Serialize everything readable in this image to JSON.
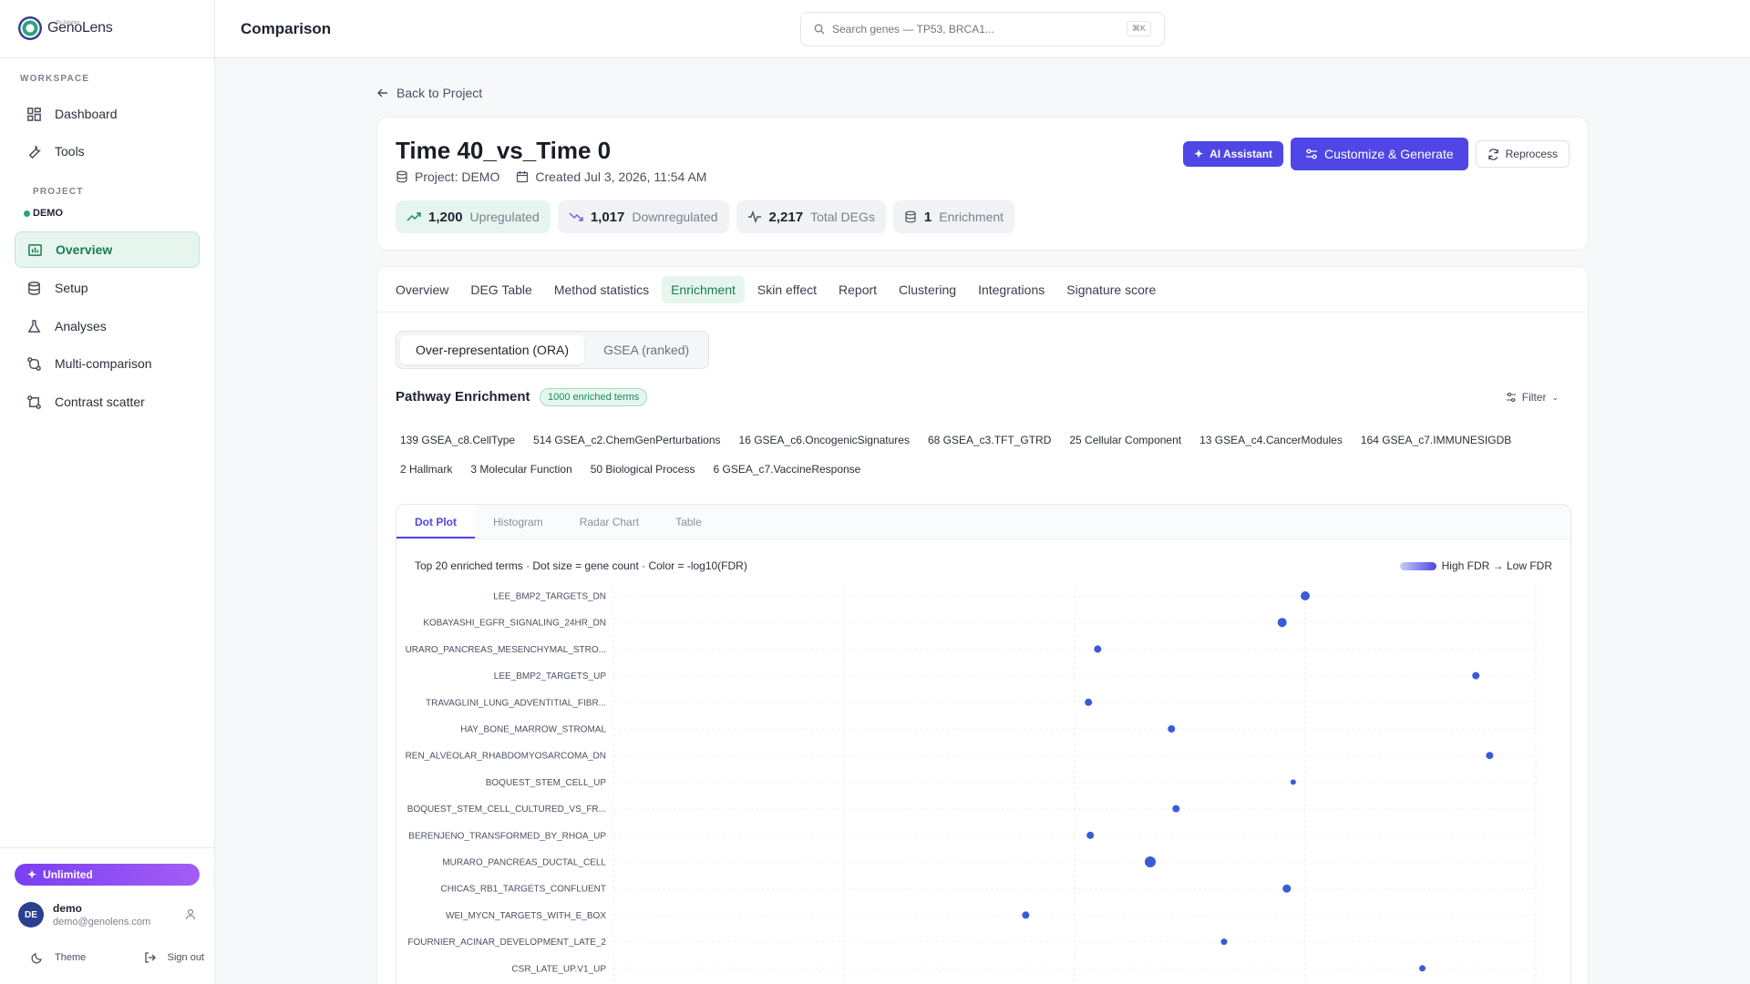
{
  "brand": {
    "name": "GenoLens",
    "sub": "By Solution"
  },
  "sidebar": {
    "workspace_label": "WORKSPACE",
    "workspace_items": [
      {
        "label": "Dashboard",
        "icon": "grid-icon"
      },
      {
        "label": "Tools",
        "icon": "wrench-icon"
      }
    ],
    "project_label": "PROJECT",
    "project_name": "DEMO",
    "project_items": [
      {
        "label": "Overview",
        "icon": "chart-icon",
        "active": true
      },
      {
        "label": "Setup",
        "icon": "database-icon"
      },
      {
        "label": "Analyses",
        "icon": "flask-icon"
      },
      {
        "label": "Multi-comparison",
        "icon": "compare-icon"
      },
      {
        "label": "Contrast scatter",
        "icon": "scatter-icon"
      }
    ],
    "plan": "Unlimited",
    "user": {
      "initials": "DE",
      "name": "demo",
      "email": "demo@genolens.com"
    },
    "theme_label": "Theme",
    "signout_label": "Sign out"
  },
  "topbar": {
    "title": "Comparison",
    "search_placeholder": "Search genes — TP53, BRCA1...",
    "kbd": "⌘K"
  },
  "header": {
    "back_label": "Back to Project",
    "title": "Time 40_vs_Time 0",
    "project": "Project: DEMO",
    "created": "Created Jul 3, 2026, 11:54 AM",
    "stats": [
      {
        "value": "1,200",
        "label": "Upregulated",
        "icon": "trend-up-icon"
      },
      {
        "value": "1,017",
        "label": "Downregulated",
        "icon": "trend-down-icon"
      },
      {
        "value": "2,217",
        "label": "Total DEGs",
        "icon": "activity-icon"
      },
      {
        "value": "1",
        "label": "Enrichment",
        "icon": "database-icon"
      }
    ],
    "ai_button": "AI Assistant",
    "generate_button": "Customize & Generate",
    "reprocess_button": "Reprocess"
  },
  "tabs": [
    "Overview",
    "DEG Table",
    "Method statistics",
    "Enrichment",
    "Skin effect",
    "Report",
    "Clustering",
    "Integrations",
    "Signature score"
  ],
  "active_tab": "Enrichment",
  "mode_tabs": [
    "Over-representation (ORA)",
    "GSEA (ranked)"
  ],
  "enrichment": {
    "title": "Pathway Enrichment",
    "badge": "1000 enriched terms",
    "filter_label": "Filter",
    "collections": [
      "139 GSEA_c8.CellType",
      "514 GSEA_c2.ChemGenPerturbations",
      "16 GSEA_c6.OncogenicSignatures",
      "68 GSEA_c3.TFT_GTRD",
      "25 Cellular Component",
      "13 GSEA_c4.CancerModules",
      "164 GSEA_c7.IMMUNESIGDB",
      "2 Hallmark",
      "3 Molecular Function",
      "50 Biological Process",
      "6 GSEA_c7.VaccineResponse"
    ],
    "plot_tabs": [
      "Dot Plot",
      "Histogram",
      "Radar Chart",
      "Table"
    ],
    "caption": "Top 20 enriched terms · Dot size = gene count · Color = -log10(FDR)",
    "legend": "High FDR → Low FDR"
  },
  "chart_data": {
    "type": "scatter",
    "title": "Top 20 enriched terms · Dot size = gene count · Color = -log10(FDR)",
    "color": "#3b5bd6",
    "terms": [
      {
        "label": "LEE_BMP2_TARGETS_DN",
        "x": 0.75,
        "size": 5
      },
      {
        "label": "KOBAYASHI_EGFR_SIGNALING_24HR_DN",
        "x": 0.725,
        "size": 5
      },
      {
        "label": "URARO_PANCREAS_MESENCHYMAL_STRO...",
        "x": 0.525,
        "size": 4
      },
      {
        "label": "LEE_BMP2_TARGETS_UP",
        "x": 0.935,
        "size": 4
      },
      {
        "label": "TRAVAGLINI_LUNG_ADVENTITIAL_FIBR...",
        "x": 0.515,
        "size": 4
      },
      {
        "label": "HAY_BONE_MARROW_STROMAL",
        "x": 0.605,
        "size": 4
      },
      {
        "label": "REN_ALVEOLAR_RHABDOMYOSARCOMA_DN",
        "x": 0.95,
        "size": 4
      },
      {
        "label": "BOQUEST_STEM_CELL_UP",
        "x": 0.737,
        "size": 3
      },
      {
        "label": "BOQUEST_STEM_CELL_CULTURED_VS_FR...",
        "x": 0.61,
        "size": 4
      },
      {
        "label": "BERENJENO_TRANSFORMED_BY_RHOA_UP",
        "x": 0.517,
        "size": 4
      },
      {
        "label": "MURARO_PANCREAS_DUCTAL_CELL",
        "x": 0.582,
        "size": 6
      },
      {
        "label": "CHICAS_RB1_TARGETS_CONFLUENT",
        "x": 0.73,
        "size": 4.5
      },
      {
        "label": "WEI_MYCN_TARGETS_WITH_E_BOX",
        "x": 0.447,
        "size": 4
      },
      {
        "label": "FOURNIER_ACINAR_DEVELOPMENT_LATE_2",
        "x": 0.662,
        "size": 3.5
      },
      {
        "label": "CSR_LATE_UP.V1_UP",
        "x": 0.877,
        "size": 3.5
      }
    ]
  }
}
